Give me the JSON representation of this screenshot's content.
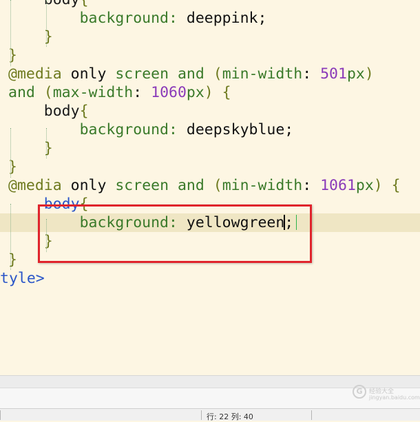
{
  "editor": {
    "lines": [
      {
        "indent": "    ",
        "tokens": [
          {
            "t": "body",
            "c": "t-sel"
          },
          {
            "t": "{",
            "c": "t-brace"
          }
        ]
      },
      {
        "indent": "        ",
        "tokens": [
          {
            "t": "background",
            "c": "t-prop"
          },
          {
            "t": ": ",
            "c": "t-prop"
          },
          {
            "t": "deeppink",
            "c": "t-val"
          },
          {
            "t": ";",
            "c": "t-val"
          }
        ]
      },
      {
        "indent": "    ",
        "tokens": [
          {
            "t": "}",
            "c": "t-brace"
          }
        ]
      },
      {
        "indent": "",
        "tokens": [
          {
            "t": "}",
            "c": "t-brace"
          }
        ]
      },
      {
        "indent": "",
        "tokens": [
          {
            "t": "@media",
            "c": "t-at"
          },
          {
            "t": " ",
            "c": "t-val"
          },
          {
            "t": "only",
            "c": "t-only"
          },
          {
            "t": " ",
            "c": "t-val"
          },
          {
            "t": "screen",
            "c": "t-kw"
          },
          {
            "t": " ",
            "c": "t-val"
          },
          {
            "t": "and",
            "c": "t-kw"
          },
          {
            "t": " (",
            "c": "t-brace"
          },
          {
            "t": "min-width",
            "c": "t-kw"
          },
          {
            "t": ": ",
            "c": "t-val"
          },
          {
            "t": "501",
            "c": "t-num"
          },
          {
            "t": "px",
            "c": "t-unit"
          },
          {
            "t": ")",
            "c": "t-brace"
          }
        ]
      },
      {
        "indent": "",
        "tokens": [
          {
            "t": "and",
            "c": "t-kw"
          },
          {
            "t": " (",
            "c": "t-brace"
          },
          {
            "t": "max-width",
            "c": "t-kw"
          },
          {
            "t": ": ",
            "c": "t-val"
          },
          {
            "t": "1060",
            "c": "t-num"
          },
          {
            "t": "px",
            "c": "t-unit"
          },
          {
            "t": ") {",
            "c": "t-brace"
          }
        ]
      },
      {
        "indent": "    ",
        "tokens": [
          {
            "t": "body",
            "c": "t-sel"
          },
          {
            "t": "{",
            "c": "t-brace"
          }
        ]
      },
      {
        "indent": "        ",
        "tokens": [
          {
            "t": "background",
            "c": "t-prop"
          },
          {
            "t": ": ",
            "c": "t-prop"
          },
          {
            "t": "deepskyblue",
            "c": "t-val"
          },
          {
            "t": ";",
            "c": "t-val"
          }
        ]
      },
      {
        "indent": "    ",
        "tokens": [
          {
            "t": "}",
            "c": "t-brace"
          }
        ]
      },
      {
        "indent": "",
        "tokens": [
          {
            "t": "}",
            "c": "t-brace"
          }
        ]
      },
      {
        "indent": "",
        "tokens": [
          {
            "t": "@media",
            "c": "t-at"
          },
          {
            "t": " ",
            "c": "t-val"
          },
          {
            "t": "only",
            "c": "t-only"
          },
          {
            "t": " ",
            "c": "t-val"
          },
          {
            "t": "screen",
            "c": "t-kw"
          },
          {
            "t": " ",
            "c": "t-val"
          },
          {
            "t": "and",
            "c": "t-kw"
          },
          {
            "t": " (",
            "c": "t-brace"
          },
          {
            "t": "min-width",
            "c": "t-kw"
          },
          {
            "t": ": ",
            "c": "t-val"
          },
          {
            "t": "1061",
            "c": "t-num"
          },
          {
            "t": "px",
            "c": "t-unit"
          },
          {
            "t": ") {",
            "c": "t-brace"
          }
        ]
      },
      {
        "indent": "    ",
        "tokens": [
          {
            "t": "body",
            "c": "t-sel-blue"
          },
          {
            "t": "{",
            "c": "t-brace"
          }
        ]
      },
      {
        "indent": "        ",
        "current": true,
        "tokens": [
          {
            "t": "background",
            "c": "t-prop"
          },
          {
            "t": ": ",
            "c": "t-prop"
          },
          {
            "t": "yellowgreen",
            "c": "t-val"
          },
          {
            "t": "|caret|",
            "c": "caret"
          },
          {
            "t": ";",
            "c": "t-val"
          },
          {
            "t": "|caret2|",
            "c": "caret2"
          }
        ]
      },
      {
        "indent": "    ",
        "tokens": [
          {
            "t": "}",
            "c": "t-brace"
          }
        ]
      },
      {
        "indent": "",
        "tokens": [
          {
            "t": "}",
            "c": "t-brace"
          }
        ]
      },
      {
        "indent": "",
        "tokens": [
          {
            "t": "tyle",
            "c": "t-tag"
          },
          {
            "t": ">",
            "c": "t-tag"
          }
        ]
      }
    ]
  },
  "status_bar": {
    "position": "行: 22 列: 40"
  },
  "watermark": {
    "icon": "G",
    "text": "经验大全",
    "url": "jingyan.baidu.com"
  },
  "colors": {
    "background": "#fdf6e3",
    "current_line": "#efe6c4",
    "highlight_box": "#e0242c"
  }
}
